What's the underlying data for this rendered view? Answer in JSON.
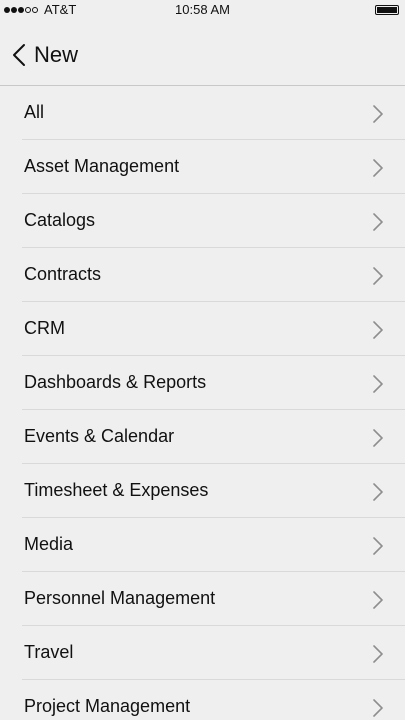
{
  "status_bar": {
    "carrier": "AT&T",
    "time": "10:58 AM",
    "signal_filled": 3,
    "signal_total": 5,
    "battery_level": 1.0
  },
  "nav": {
    "title": "New",
    "back_icon": "chevron-left-icon"
  },
  "list": {
    "items": [
      {
        "label": "All"
      },
      {
        "label": "Asset Management"
      },
      {
        "label": "Catalogs"
      },
      {
        "label": "Contracts"
      },
      {
        "label": "CRM"
      },
      {
        "label": "Dashboards & Reports"
      },
      {
        "label": "Events & Calendar"
      },
      {
        "label": "Timesheet & Expenses"
      },
      {
        "label": "Media"
      },
      {
        "label": "Personnel Management"
      },
      {
        "label": "Travel"
      },
      {
        "label": "Project Management"
      }
    ],
    "item_icon": "chevron-right-icon"
  },
  "colors": {
    "background": "#efefef",
    "text": "#111111",
    "divider": "#d9d9d9",
    "chevron": "#8e8e8e"
  }
}
